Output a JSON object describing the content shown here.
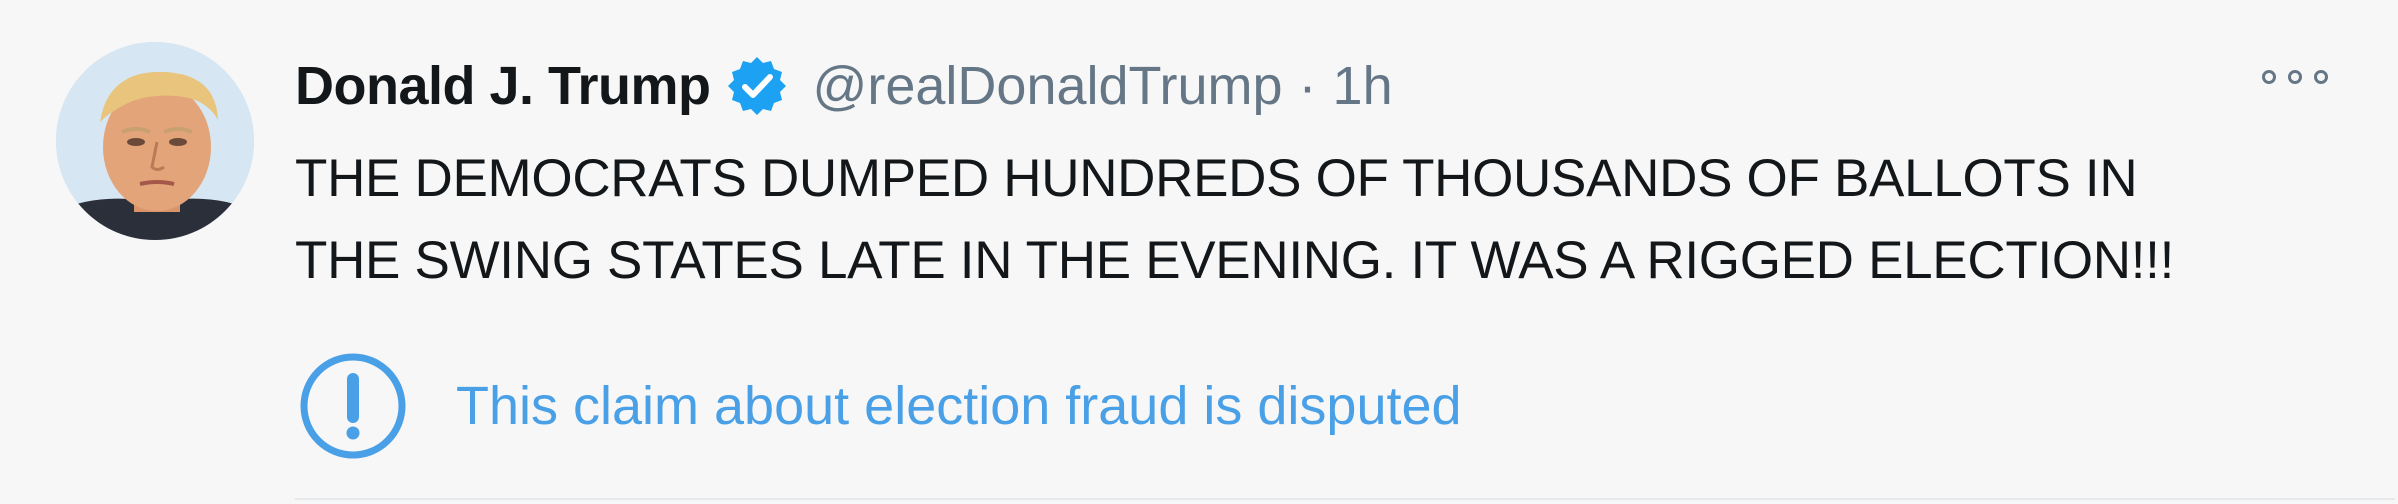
{
  "tweet": {
    "display_name": "Donald J. Trump",
    "handle": "@realDonaldTrump",
    "separator": "·",
    "time": "1h",
    "text_line1": "THE DEMOCRATS DUMPED HUNDREDS OF THOUSANDS OF BALLOTS IN",
    "text_line2": "THE SWING STATES LATE IN THE EVENING. IT WAS A RIGGED ELECTION!!!"
  },
  "warning": {
    "label": "This claim about election fraud is disputed",
    "icon": "exclamation-circle-icon"
  },
  "icons": {
    "verified": "verified-badge-icon",
    "more": "more-options-icon"
  },
  "colors": {
    "background": "#f7f7f7",
    "text": "#14171a",
    "secondary": "#657786",
    "verified": "#1da1f2",
    "warning": "#4aa0e6"
  }
}
